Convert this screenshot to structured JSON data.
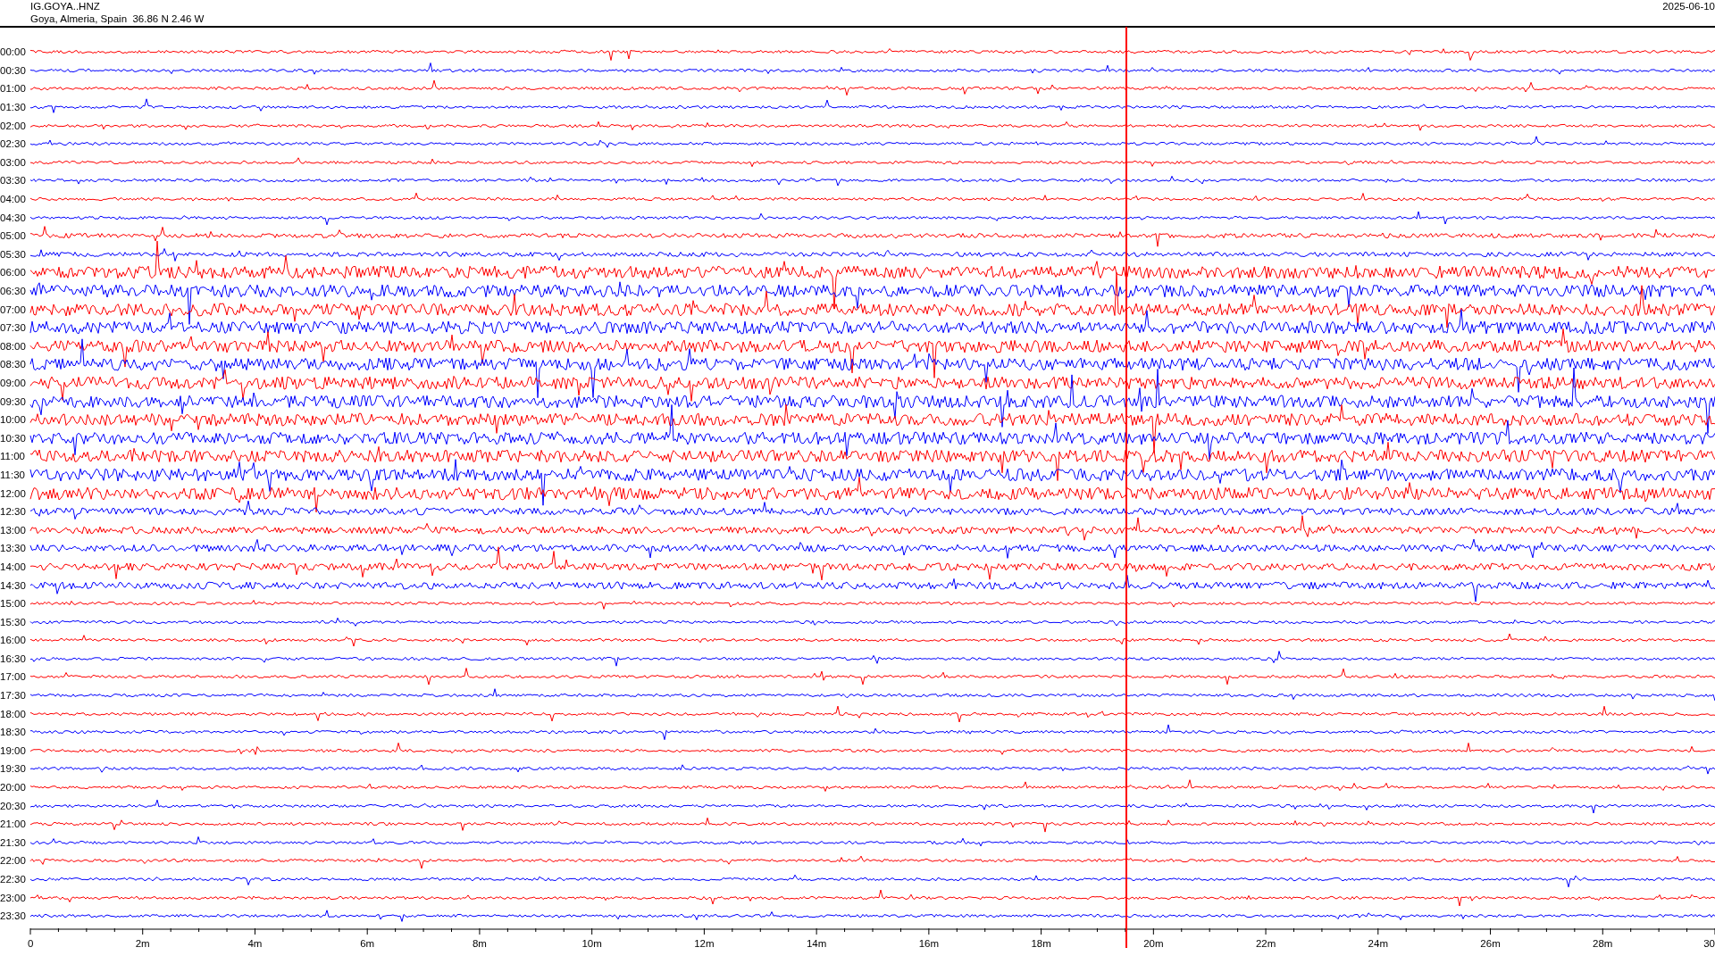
{
  "header": {
    "station": "IG.GOYA..HNZ",
    "location": "Goya, Almeria, Spain  36.86 N 2.46 W",
    "date": "2025-06-10"
  },
  "traces": [
    {
      "time": "00:00",
      "color": "#ff0000"
    },
    {
      "time": "00:30",
      "color": "#0000ff"
    },
    {
      "time": "01:00",
      "color": "#ff0000"
    },
    {
      "time": "01:30",
      "color": "#0000ff"
    },
    {
      "time": "02:00",
      "color": "#ff0000"
    },
    {
      "time": "02:30",
      "color": "#0000ff"
    },
    {
      "time": "03:00",
      "color": "#ff0000"
    },
    {
      "time": "03:30",
      "color": "#0000ff"
    },
    {
      "time": "04:00",
      "color": "#ff0000"
    },
    {
      "time": "04:30",
      "color": "#0000ff"
    },
    {
      "time": "05:00",
      "color": "#ff0000"
    },
    {
      "time": "05:30",
      "color": "#0000ff"
    },
    {
      "time": "06:00",
      "color": "#ff0000"
    },
    {
      "time": "06:30",
      "color": "#0000ff"
    },
    {
      "time": "07:00",
      "color": "#ff0000"
    },
    {
      "time": "07:30",
      "color": "#0000ff"
    },
    {
      "time": "08:00",
      "color": "#ff0000"
    },
    {
      "time": "08:30",
      "color": "#0000ff"
    },
    {
      "time": "09:00",
      "color": "#ff0000"
    },
    {
      "time": "09:30",
      "color": "#0000ff"
    },
    {
      "time": "10:00",
      "color": "#ff0000"
    },
    {
      "time": "10:30",
      "color": "#0000ff"
    },
    {
      "time": "11:00",
      "color": "#ff0000"
    },
    {
      "time": "11:30",
      "color": "#0000ff"
    },
    {
      "time": "12:00",
      "color": "#ff0000"
    },
    {
      "time": "12:30",
      "color": "#0000ff"
    },
    {
      "time": "13:00",
      "color": "#ff0000"
    },
    {
      "time": "13:30",
      "color": "#0000ff"
    },
    {
      "time": "14:00",
      "color": "#ff0000"
    },
    {
      "time": "14:30",
      "color": "#0000ff"
    },
    {
      "time": "15:00",
      "color": "#ff0000"
    },
    {
      "time": "15:30",
      "color": "#0000ff"
    },
    {
      "time": "16:00",
      "color": "#ff0000"
    },
    {
      "time": "16:30",
      "color": "#0000ff"
    },
    {
      "time": "17:00",
      "color": "#ff0000"
    },
    {
      "time": "17:30",
      "color": "#0000ff"
    },
    {
      "time": "18:00",
      "color": "#ff0000"
    },
    {
      "time": "18:30",
      "color": "#0000ff"
    },
    {
      "time": "19:00",
      "color": "#ff0000"
    },
    {
      "time": "19:30",
      "color": "#0000ff"
    },
    {
      "time": "20:00",
      "color": "#ff0000"
    },
    {
      "time": "20:30",
      "color": "#0000ff"
    },
    {
      "time": "21:00",
      "color": "#ff0000"
    },
    {
      "time": "21:30",
      "color": "#0000ff"
    },
    {
      "time": "22:00",
      "color": "#ff0000"
    },
    {
      "time": "22:30",
      "color": "#0000ff"
    },
    {
      "time": "23:00",
      "color": "#ff0000"
    },
    {
      "time": "23:30",
      "color": "#0000ff"
    }
  ],
  "time_axis": {
    "labels": [
      "0",
      "2m",
      "4m",
      "6m",
      "8m",
      "10m",
      "12m",
      "14m",
      "16m",
      "18m",
      "20m",
      "22m",
      "24m",
      "26m",
      "28m",
      "30"
    ]
  }
}
